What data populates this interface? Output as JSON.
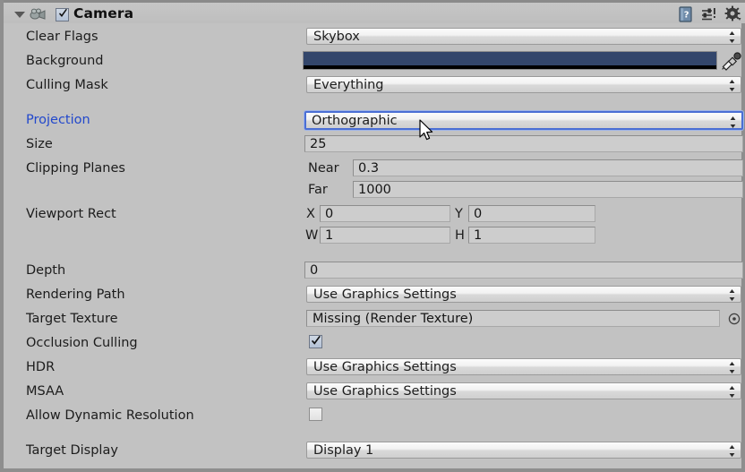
{
  "component": {
    "title": "Camera",
    "enabled_checkbox": true,
    "foldout_expanded": true,
    "icons": [
      "help-icon",
      "preset-icon",
      "gear-icon"
    ]
  },
  "accent": {
    "modified_label": "#2248cc",
    "focus_border": "#4b6fd4",
    "panel_bg": "#c2c2c2",
    "field_bg": "#cdcdcd",
    "background_color": "#33466b"
  },
  "rows": {
    "clear_flags": {
      "label": "Clear Flags",
      "value": "Skybox"
    },
    "background": {
      "label": "Background",
      "color": "#33466b",
      "alpha_bar": "#000000",
      "eyedropper": "eyedropper-icon"
    },
    "culling_mask": {
      "label": "Culling Mask",
      "value": "Everything"
    },
    "projection": {
      "label": "Projection",
      "value": "Orthographic",
      "modified": true,
      "focused": true
    },
    "size": {
      "label": "Size",
      "value": "25"
    },
    "clipping_planes": {
      "label": "Clipping Planes",
      "near_label": "Near",
      "near_value": "0.3",
      "far_label": "Far",
      "far_value": "1000"
    },
    "viewport_rect": {
      "label": "Viewport Rect",
      "x_label": "X",
      "x_value": "0",
      "y_label": "Y",
      "y_value": "0",
      "w_label": "W",
      "w_value": "1",
      "h_label": "H",
      "h_value": "1"
    },
    "depth": {
      "label": "Depth",
      "value": "0"
    },
    "rendering_path": {
      "label": "Rendering Path",
      "value": "Use Graphics Settings"
    },
    "target_texture": {
      "label": "Target Texture",
      "value": "Missing (Render Texture)",
      "picker": "object-picker-icon"
    },
    "occlusion_culling": {
      "label": "Occlusion Culling",
      "checked": true
    },
    "hdr": {
      "label": "HDR",
      "value": "Use Graphics Settings"
    },
    "msaa": {
      "label": "MSAA",
      "value": "Use Graphics Settings"
    },
    "allow_dynamic_resolution": {
      "label": "Allow Dynamic Resolution",
      "checked": false
    },
    "target_display": {
      "label": "Target Display",
      "value": "Display 1"
    }
  }
}
